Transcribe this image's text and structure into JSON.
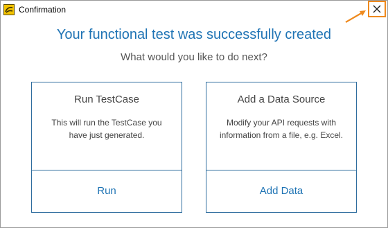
{
  "window": {
    "title": "Confirmation",
    "icon": "soapui-icon",
    "close_icon": "close-icon",
    "highlight_color": "#ef8a1e"
  },
  "main": {
    "headline": "Your functional test was successfully created",
    "subheadline": "What would you like to do next?",
    "accent_color": "#1e73b4"
  },
  "cards": [
    {
      "title": "Run TestCase",
      "description_lines": [
        "This will run the TestCase you",
        "have just generated."
      ],
      "action_label": "Run"
    },
    {
      "title": "Add a Data Source",
      "description_lines": [
        "Modify your API requests with",
        "information from a file, e.g. Excel."
      ],
      "action_label": "Add Data"
    }
  ]
}
